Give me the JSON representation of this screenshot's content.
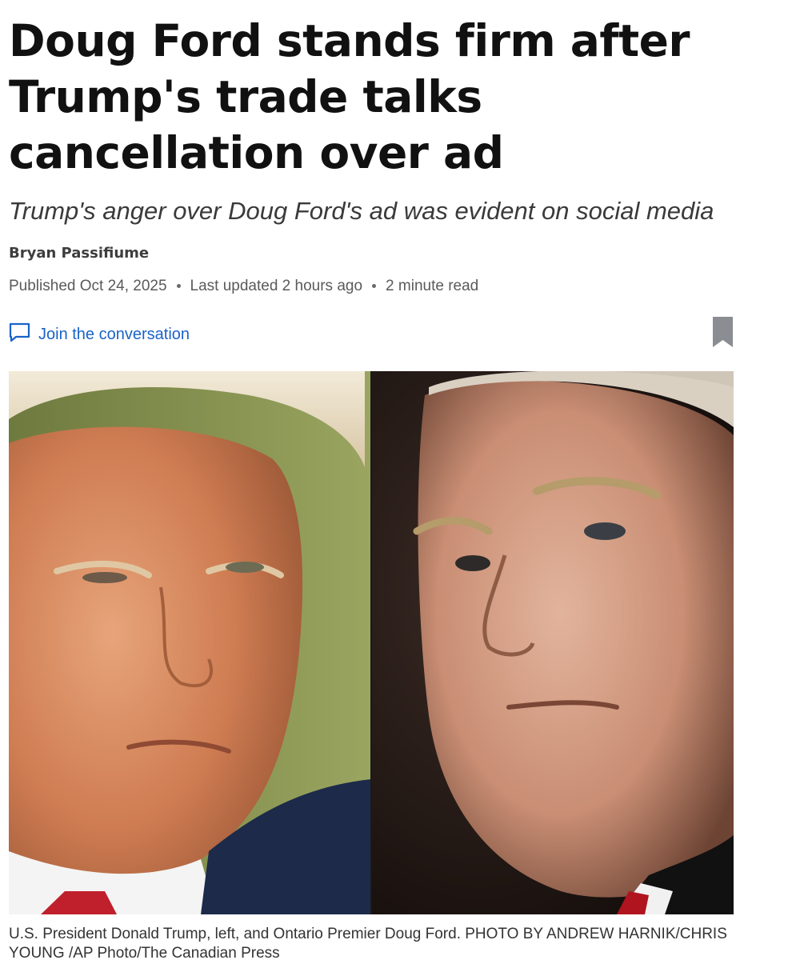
{
  "article": {
    "headline": "Doug Ford stands firm after Trump's trade talks cancellation over ad",
    "deck": "Trump's anger over Doug Ford's ad was evident on social media",
    "author": "Bryan Passifiume",
    "published": "Published Oct 24, 2025",
    "updated": "Last updated 2 hours ago",
    "read_time": "2 minute read",
    "join_label": "Join the conversation",
    "join_icon": "comment-icon",
    "bookmark_icon": "bookmark-icon",
    "caption": "U.S. President Donald Trump, left, and Ontario Premier Doug Ford. PHOTO BY ANDREW HARNIK/CHRIS YOUNG /AP Photo/The Canadian Press"
  },
  "colors": {
    "link": "#1a63c9",
    "bookmark": "#8a8d91",
    "headline": "#111111",
    "meta": "#5a5a5a"
  }
}
